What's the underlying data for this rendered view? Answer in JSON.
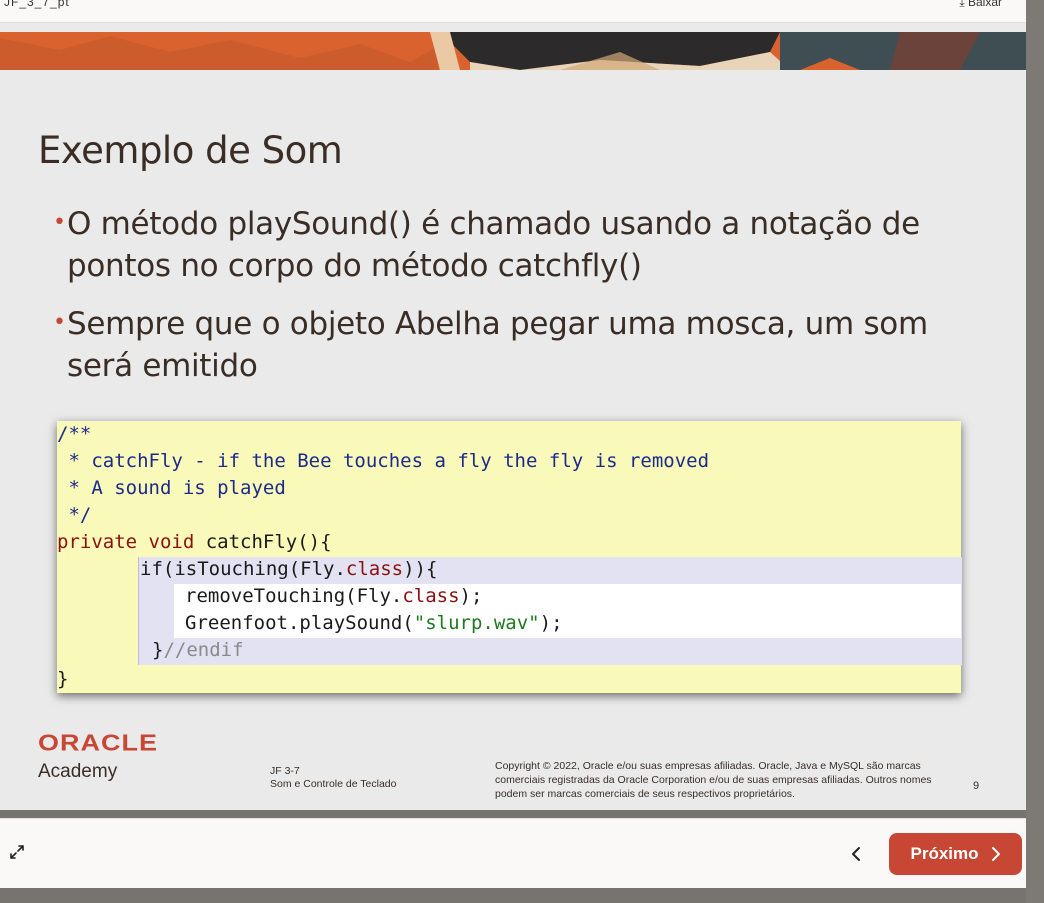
{
  "topbar": {
    "breadcrumb": "JF_3_7_pt",
    "download_label": "Baixar"
  },
  "slide": {
    "title": "Exemplo de Som",
    "bullets": [
      "O método playSound() é chamado usando a notação de pontos no corpo do método catchfly()",
      "Sempre que o objeto Abelha pegar uma mosca, um som será emitido"
    ],
    "code": {
      "line1": "/**",
      "line2": " * catchFly - if the Bee touches a fly the fly is removed",
      "line3": " * A sound is played",
      "line4": " */",
      "line5_kw1": "private",
      "line5_kw2": "void",
      "line5_rest": " catchFly(){",
      "line6_if": "if(isTouching(Fly.",
      "line6_kw": "class",
      "line6_end": ")){",
      "line7_a": "removeTouching(Fly.",
      "line7_kw": "class",
      "line7_end": ");",
      "line8_a": "Greenfoot.playSound(",
      "line8_str": "\"slurp.wav\"",
      "line8_end": ");",
      "line9_brace": "}",
      "line9_comment": "//endif",
      "line10": "}"
    },
    "footer": {
      "brand": "ORACLE",
      "sub_brand": "Academy",
      "course_code": "JF 3-7",
      "course_title": "Som e Controle de Teclado",
      "copyright": "Copyright © 2022, Oracle e/ou suas empresas afiliadas. Oracle, Java e MySQL são marcas comerciais registradas da Oracle Corporation e/ou de suas empresas afiliadas. Outros nomes podem ser marcas comerciais de seus respectivos proprietários.",
      "page_number": "9"
    }
  },
  "navigation": {
    "next_label": "Próximo",
    "icons": {
      "expand": "expand-icon",
      "previous": "chevron-left-icon",
      "next": "chevron-right-icon",
      "download": "download-icon"
    }
  },
  "colors": {
    "accent": "#c74634",
    "text": "#3a2d26",
    "slide_bg": "#eaeaea",
    "code_bg": "#f9f9b9"
  }
}
